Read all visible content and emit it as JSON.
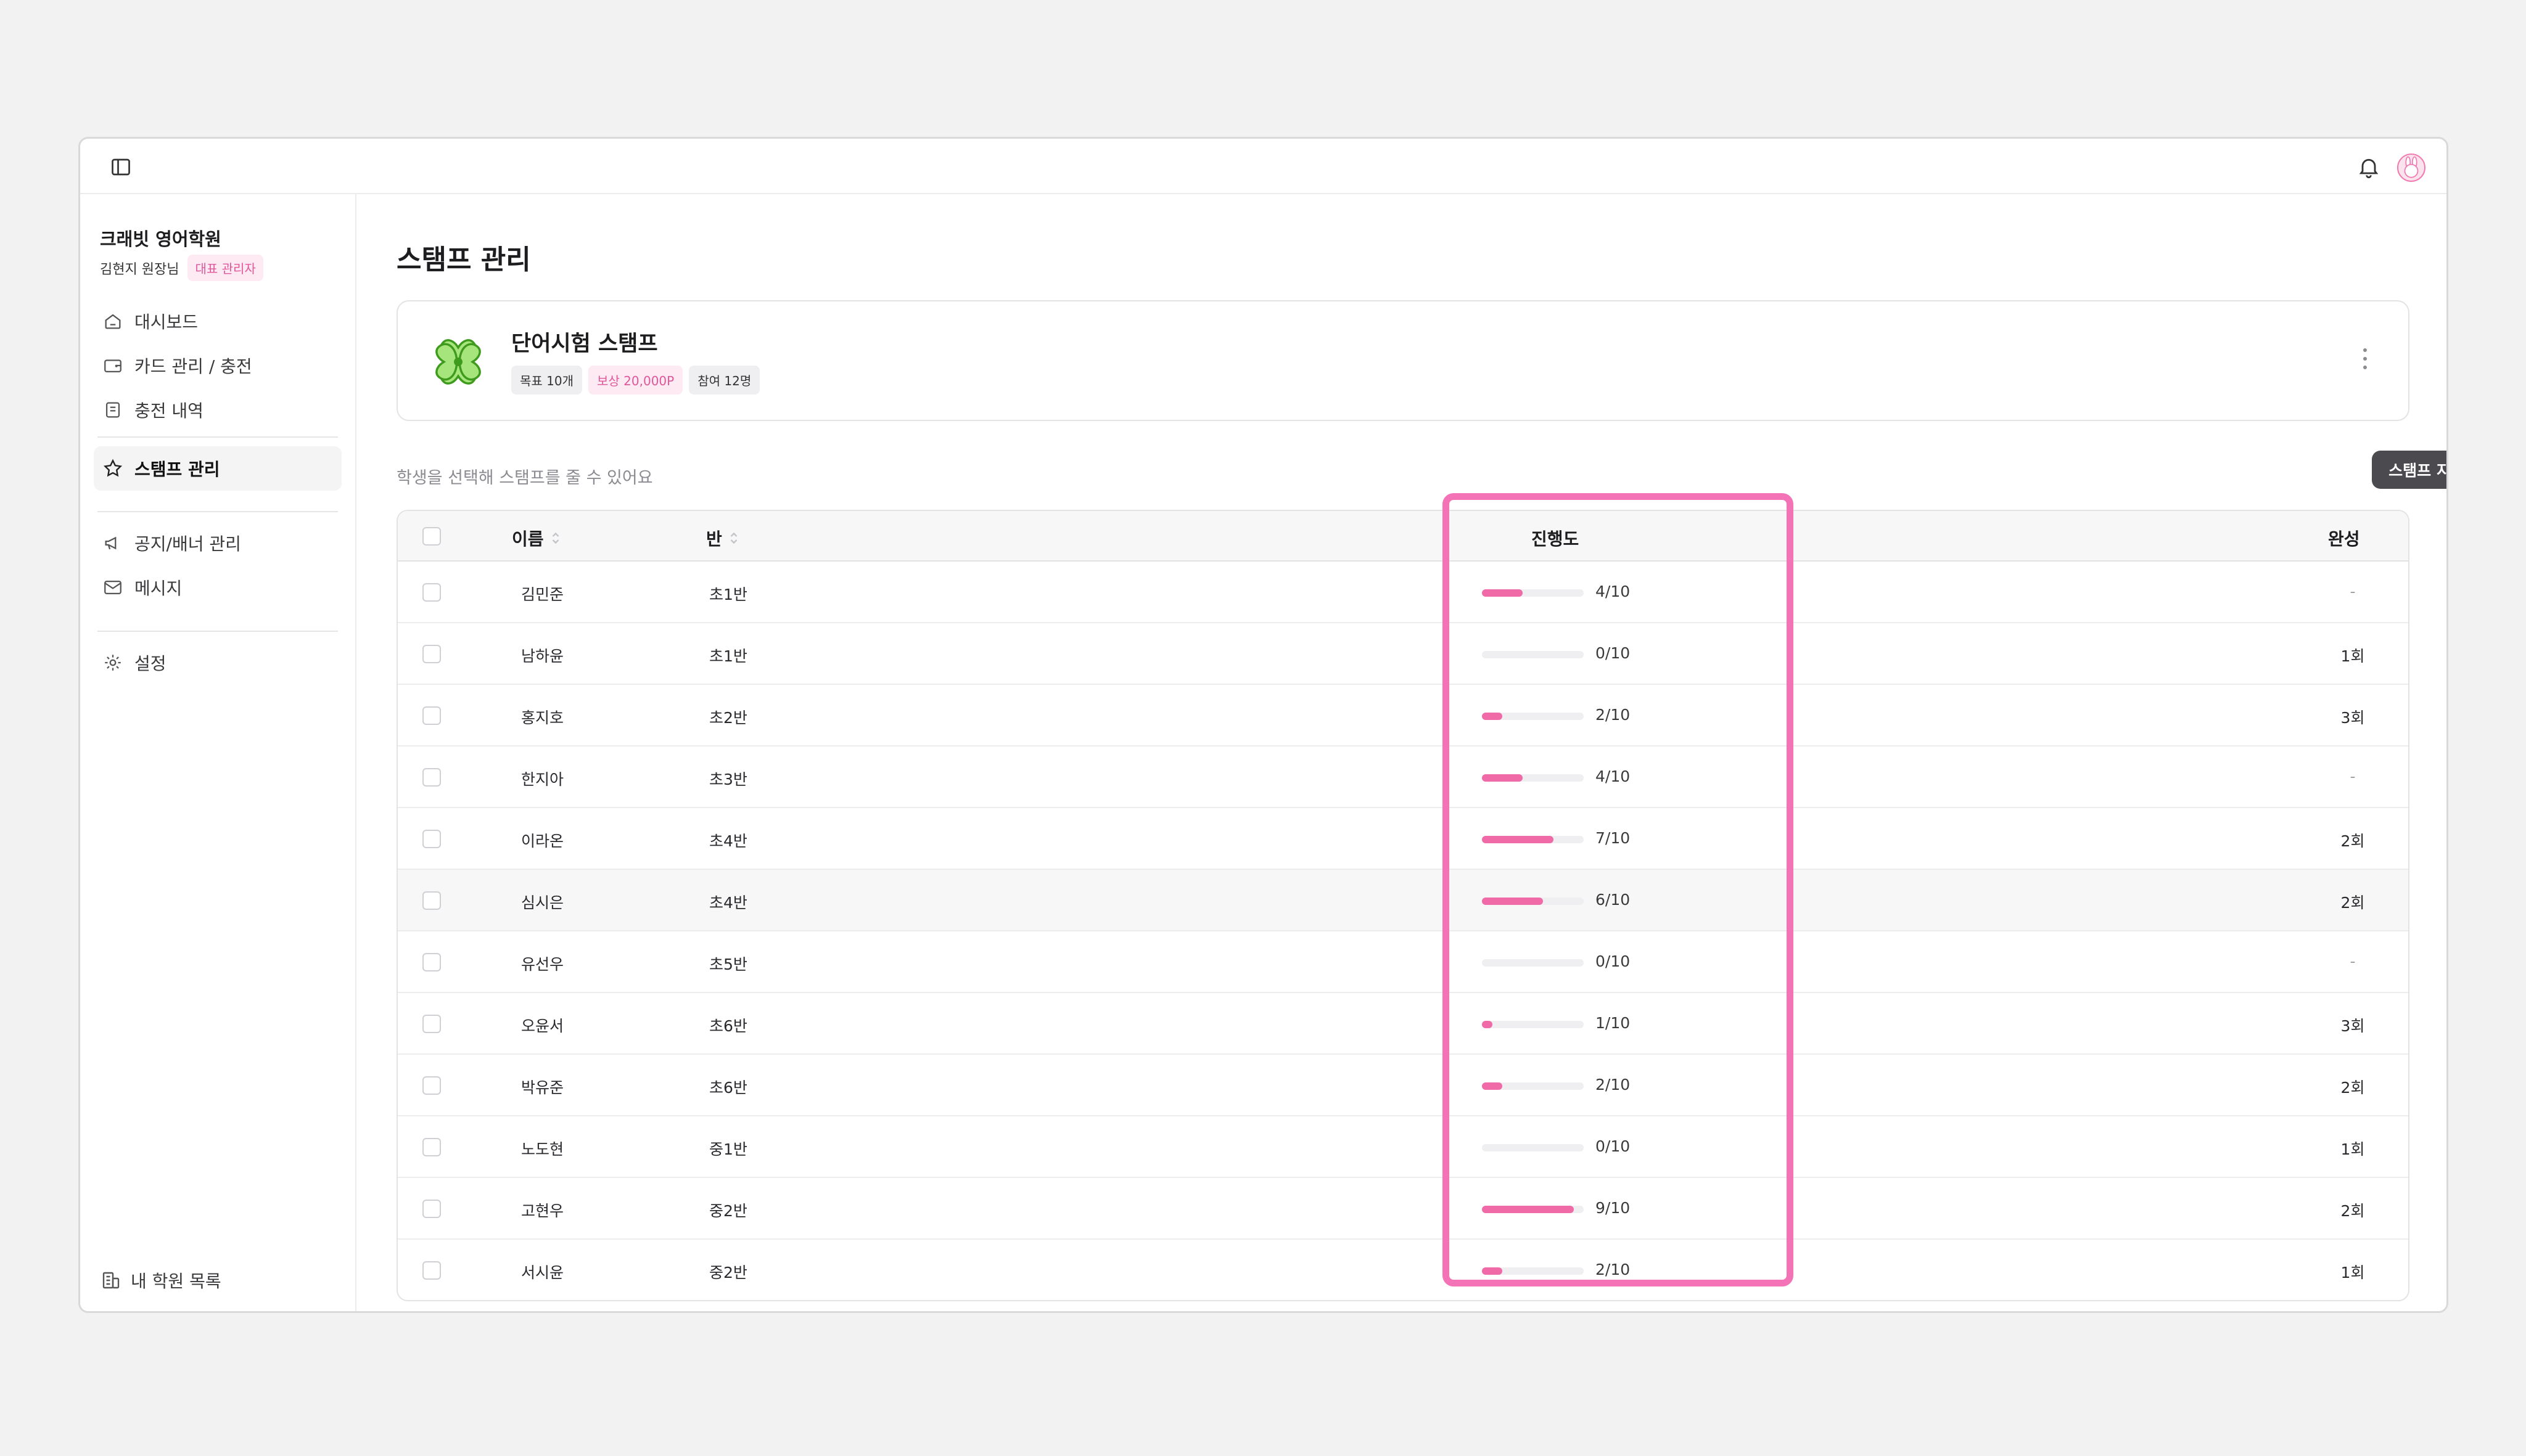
{
  "sidebar": {
    "org_name": "크래빗 영어학원",
    "user_name": "김현지 원장님",
    "role_badge": "대표 관리자",
    "nav": [
      {
        "label": "대시보드",
        "icon": "home-icon"
      },
      {
        "label": "카드 관리 / 충전",
        "icon": "wallet-icon"
      },
      {
        "label": "충전 내역",
        "icon": "receipt-icon"
      },
      {
        "label": "스탬프 관리",
        "icon": "star-icon",
        "active": true
      },
      {
        "label": "공지/배너 관리",
        "icon": "megaphone-icon"
      },
      {
        "label": "메시지",
        "icon": "mail-icon"
      },
      {
        "label": "설정",
        "icon": "gear-icon"
      }
    ],
    "footer_label": "내 학원 목록"
  },
  "page": {
    "title": "스탬프 관리",
    "hint": "학생을 선택해 스탬프를 줄 수 있어요",
    "give_button": "스탬프 지급"
  },
  "stamp": {
    "name": "단어시험 스탬프",
    "tags": [
      "목표 10개",
      "보상 20,000P",
      "참여 12명"
    ]
  },
  "table": {
    "headers": {
      "name": "이름",
      "class": "반",
      "progress": "진행도",
      "completed": "완성"
    },
    "rows": [
      {
        "name": "김민준",
        "class": "초1반",
        "progress": 4,
        "progress_label": "4/10",
        "completed": "-"
      },
      {
        "name": "남하윤",
        "class": "초1반",
        "progress": 0,
        "progress_label": "0/10",
        "completed": "1회"
      },
      {
        "name": "홍지호",
        "class": "초2반",
        "progress": 2,
        "progress_label": "2/10",
        "completed": "3회"
      },
      {
        "name": "한지아",
        "class": "초3반",
        "progress": 4,
        "progress_label": "4/10",
        "completed": "-"
      },
      {
        "name": "이라온",
        "class": "초4반",
        "progress": 7,
        "progress_label": "7/10",
        "completed": "2회"
      },
      {
        "name": "심시은",
        "class": "초4반",
        "progress": 6,
        "progress_label": "6/10",
        "completed": "2회"
      },
      {
        "name": "유선우",
        "class": "초5반",
        "progress": 0,
        "progress_label": "0/10",
        "completed": "-"
      },
      {
        "name": "오윤서",
        "class": "초6반",
        "progress": 1,
        "progress_label": "1/10",
        "completed": "3회"
      },
      {
        "name": "박유준",
        "class": "초6반",
        "progress": 2,
        "progress_label": "2/10",
        "completed": "2회"
      },
      {
        "name": "노도현",
        "class": "중1반",
        "progress": 0,
        "progress_label": "0/10",
        "completed": "1회"
      },
      {
        "name": "고현우",
        "class": "중2반",
        "progress": 9,
        "progress_label": "9/10",
        "completed": "2회"
      },
      {
        "name": "서시윤",
        "class": "중2반",
        "progress": 2,
        "progress_label": "2/10",
        "completed": "1회"
      }
    ],
    "progress_max": 10
  },
  "colors": {
    "accent": "#f06aa8",
    "highlight": "#f472b6",
    "button": "#4a4a4f"
  }
}
